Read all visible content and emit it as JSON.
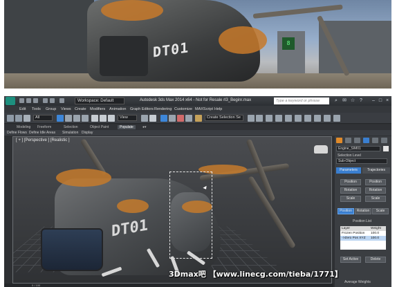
{
  "photo": {
    "hull_text": "DT01",
    "sign_text": "8",
    "colors": {
      "rust": "#c7792a",
      "sky": "#97aecb"
    }
  },
  "window": {
    "workspace_label": "Workspace: Default",
    "title": "Autodesk 3ds Max 2014 x64 - Not for Resale  rl3_Beginr.max",
    "search_placeholder": "Type a keyword or phrase",
    "icons": [
      "save-icon",
      "undo-icon",
      "redo-icon",
      "help-icon"
    ]
  },
  "menubar": {
    "items": [
      "Edit",
      "Tools",
      "Group",
      "Views",
      "Create",
      "Modifiers",
      "Animation",
      "Graph Editors",
      "Rendering",
      "Customize",
      "MAXScript",
      "Help"
    ]
  },
  "toolbar": {
    "selection_filter": "All",
    "view_dropdown": "View",
    "selection_set": "Create Selection Se"
  },
  "ribbon": {
    "tabs": [
      "Modeling",
      "Freeform",
      "Selection",
      "Object Paint",
      "Populate"
    ],
    "active_tab": "Populate",
    "sub_items": [
      "Define Flows",
      "Define Idle Areas",
      "Simulation",
      "Display"
    ]
  },
  "viewport": {
    "label": "[ + ] [Perspective ] [Realistic ]",
    "hull_text": "DT01"
  },
  "command_panel": {
    "object_name": "Engine_SIM01",
    "selection_level_label": "Selection Level",
    "selection_level_value": "Sub-Object",
    "tab_parameters": "Parameters",
    "tab_trajectories": "Trajectories",
    "buttons": {
      "position": "Position",
      "rotation": "Rotation",
      "scale": "Scale",
      "position_sub": "Position",
      "rotation_sub": "Rotation",
      "scale_sub": "Scale"
    },
    "position_list_label": "Position List",
    "list_header": {
      "layer": "Layer",
      "weight": "Weight"
    },
    "list_rows": [
      {
        "layer": "Frozen Position",
        "weight": "100.0"
      },
      {
        "layer": "->Zero Pos XYZ",
        "weight": "100.0"
      }
    ],
    "set_active": "Set Active",
    "delete": "Delete",
    "average_weights": "Average Weights"
  },
  "timeline": {
    "frame": "0 / 100"
  },
  "watermark": "3Dmax吧 【www.linecg.com/tieba/1771】"
}
